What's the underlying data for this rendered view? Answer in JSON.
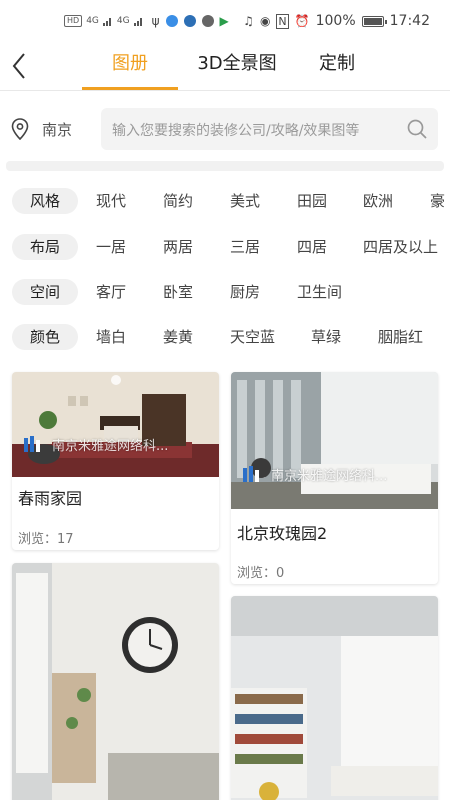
{
  "status_bar": {
    "left_badges": [
      "HD",
      "4G",
      "4G"
    ],
    "battery": "100%",
    "time": "17:42"
  },
  "nav": {
    "back_icon": "chevron-left-icon",
    "tabs": [
      "图册",
      "3D全景图",
      "定制"
    ],
    "active_tab": 0,
    "accent_color": "#f0a020"
  },
  "search": {
    "location": "南京",
    "placeholder": "输入您要搜索的装修公司/攻略/效果图等",
    "location_icon": "location-pin-icon",
    "search_icon": "search-icon"
  },
  "filters": [
    {
      "label": "风格",
      "options": [
        "现代",
        "简约",
        "美式",
        "田园",
        "欧洲",
        "豪"
      ]
    },
    {
      "label": "布局",
      "options": [
        "一居",
        "两居",
        "三居",
        "四居",
        "四居及以上"
      ]
    },
    {
      "label": "空间",
      "options": [
        "客厅",
        "卧室",
        "厨房",
        "卫生间"
      ]
    },
    {
      "label": "颜色",
      "options": [
        "墙白",
        "姜黄",
        "天空蓝",
        "草绿",
        "胭脂红"
      ]
    }
  ],
  "cards": [
    {
      "title": "春雨家园",
      "views": "浏览：17",
      "watermark": "南京米雅途网络科..."
    },
    {
      "title": "北京玫瑰园2",
      "views": "浏览：0",
      "watermark": "南京米雅途网络科..."
    },
    {
      "title": "",
      "views": "",
      "watermark": ""
    },
    {
      "title": "",
      "views": "",
      "watermark": ""
    }
  ]
}
